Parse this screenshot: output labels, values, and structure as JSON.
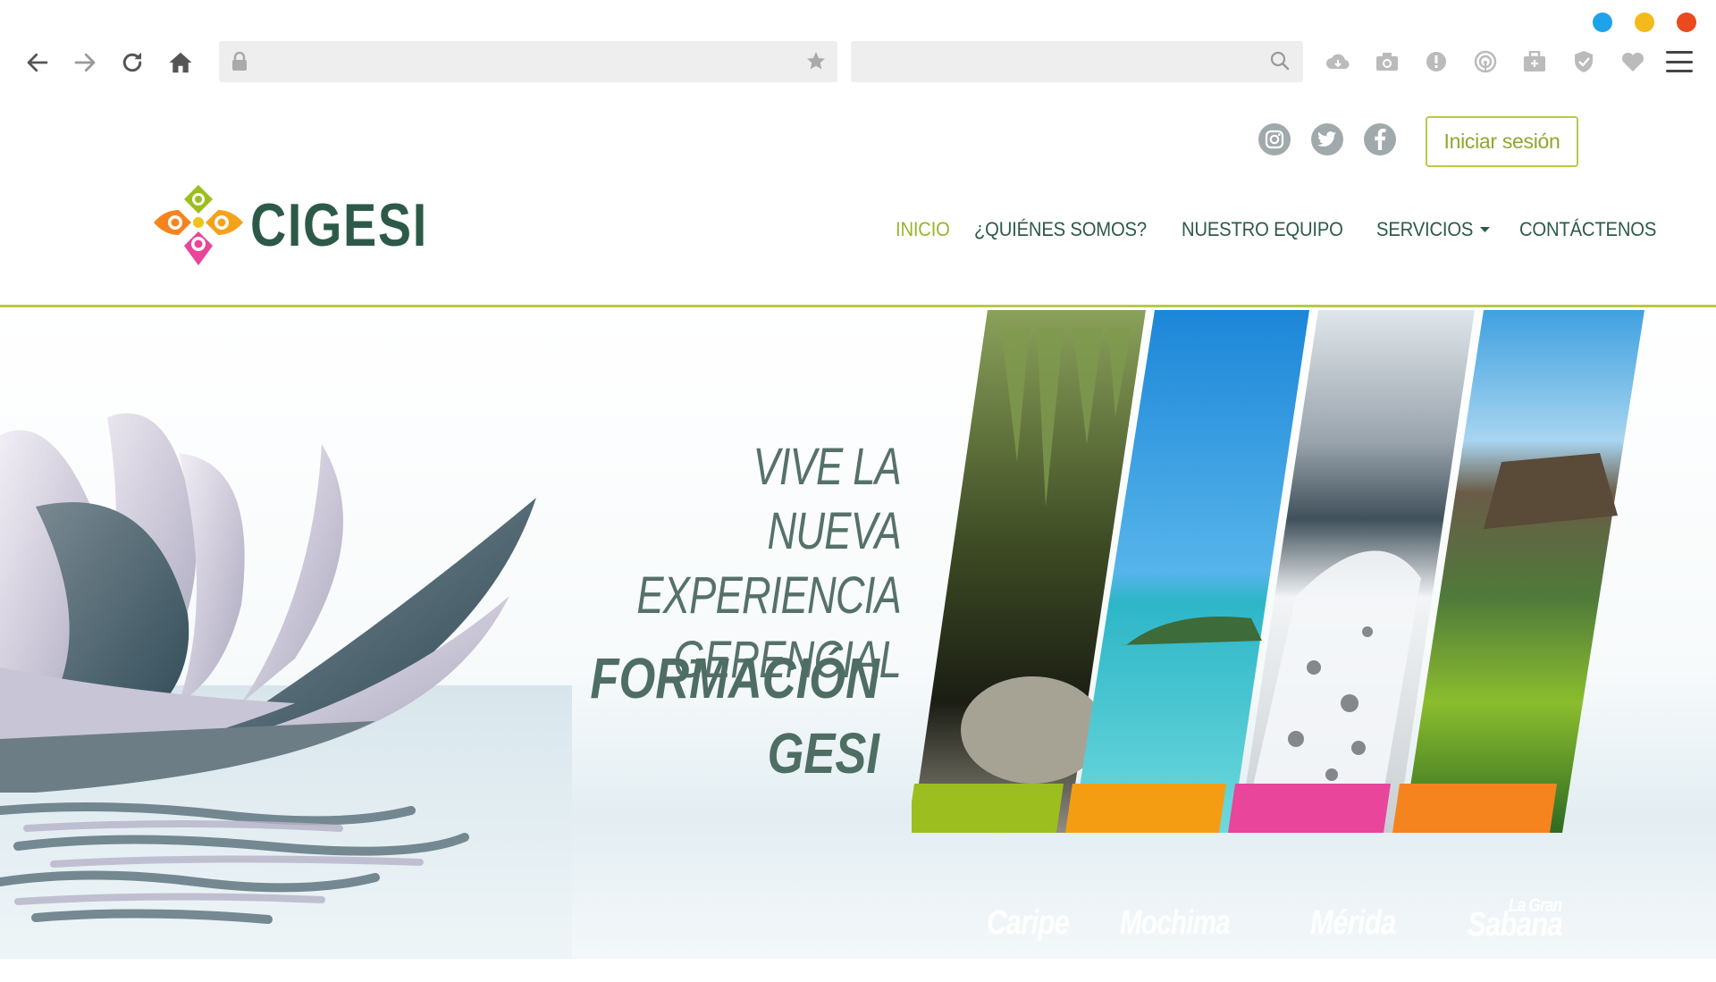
{
  "browser": {
    "traffic_colors": [
      "#1ea2e9",
      "#f4b91a",
      "#e94b1f"
    ],
    "icons": [
      "back-icon",
      "forward-icon",
      "reload-icon",
      "home-icon",
      "lock-icon",
      "star-icon",
      "search-icon",
      "cloud-icon",
      "camera-icon",
      "alert-icon",
      "rss-icon",
      "briefcase-icon",
      "shield-icon",
      "heart-icon",
      "menu-icon"
    ]
  },
  "header": {
    "logo_text": "CIGESI",
    "login_label": "Iniciar sesión",
    "social": [
      "instagram-icon",
      "twitter-icon",
      "facebook-icon"
    ],
    "nav": [
      {
        "label": "INICIO",
        "active": true
      },
      {
        "label": "¿QUIÉNES SOMOS?"
      },
      {
        "label": "NUESTRO EQUIPO"
      },
      {
        "label": "SERVICIOS",
        "dropdown": true
      },
      {
        "label": "CONTÁCTENOS"
      }
    ],
    "accent": "#b9c947"
  },
  "hero": {
    "line1": "VIVE LA NUEVA",
    "line2": "EXPERIENCIA",
    "line3": "GERENCIAL",
    "line4": "FORMACIÓN",
    "line5": "GESI",
    "panels": [
      {
        "label": "Caripe",
        "color": "#9cbe1e"
      },
      {
        "label": "Mochima",
        "color": "#f59d12"
      },
      {
        "label": "Mérida",
        "color": "#e8459b"
      },
      {
        "label_small": "La Gran",
        "label": "Sabana",
        "color": "#f5841f"
      }
    ]
  }
}
